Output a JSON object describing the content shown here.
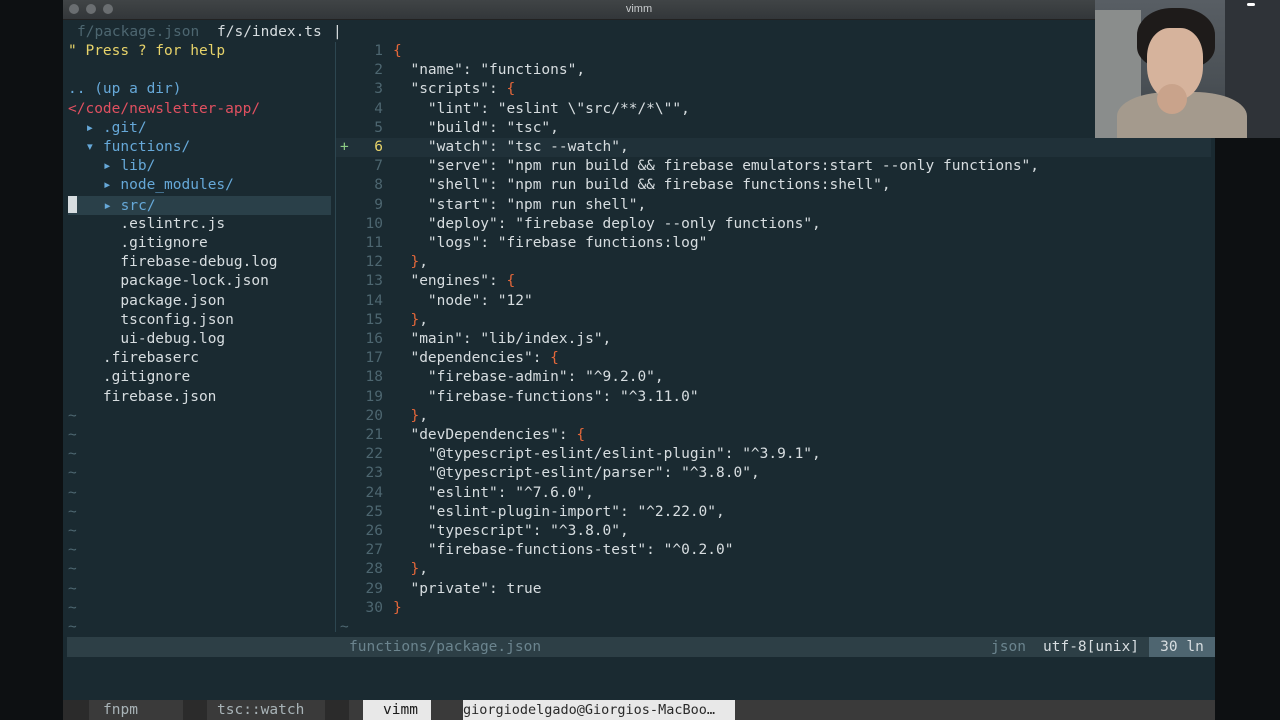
{
  "window": {
    "title": "vimm"
  },
  "tabs": [
    {
      "label": "f/package.json",
      "active": false
    },
    {
      "label": "f/s/index.ts",
      "active": true
    }
  ],
  "tab_separator": "|",
  "tree": {
    "help": "\" Press ? for help",
    "updir": ".. (up a dir)",
    "root": "</code/newsletter-app/",
    "items": [
      {
        "arrow": "▸",
        "label": ".git/",
        "indent": 0,
        "type": "dir"
      },
      {
        "arrow": "▾",
        "label": "functions/",
        "indent": 0,
        "type": "dir"
      },
      {
        "arrow": "▸",
        "label": "lib/",
        "indent": 1,
        "type": "dir"
      },
      {
        "arrow": "▸",
        "label": "node_modules/",
        "indent": 1,
        "type": "dir"
      },
      {
        "arrow": "▸",
        "label": "src/",
        "indent": 1,
        "type": "dir",
        "selected": true
      },
      {
        "arrow": "",
        "label": ".eslintrc.js",
        "indent": 1,
        "type": "file"
      },
      {
        "arrow": "",
        "label": ".gitignore",
        "indent": 1,
        "type": "file"
      },
      {
        "arrow": "",
        "label": "firebase-debug.log",
        "indent": 1,
        "type": "file"
      },
      {
        "arrow": "",
        "label": "package-lock.json",
        "indent": 1,
        "type": "file"
      },
      {
        "arrow": "",
        "label": "package.json",
        "indent": 1,
        "type": "file"
      },
      {
        "arrow": "",
        "label": "tsconfig.json",
        "indent": 1,
        "type": "file"
      },
      {
        "arrow": "",
        "label": "ui-debug.log",
        "indent": 1,
        "type": "file"
      },
      {
        "arrow": "",
        "label": ".firebaserc",
        "indent": 0,
        "type": "file"
      },
      {
        "arrow": "",
        "label": ".gitignore",
        "indent": 0,
        "type": "file"
      },
      {
        "arrow": "",
        "label": "firebase.json",
        "indent": 0,
        "type": "file"
      }
    ],
    "tilde": "~"
  },
  "editor": {
    "current_line": 6,
    "added_sign": "+",
    "lines": [
      "{",
      "  \"name\": \"functions\",",
      "  \"scripts\": {",
      "    \"lint\": \"eslint \\\"src/**/*\\\"\",",
      "    \"build\": \"tsc\",",
      "    \"watch\": \"tsc --watch\",",
      "    \"serve\": \"npm run build && firebase emulators:start --only functions\",",
      "    \"shell\": \"npm run build && firebase functions:shell\",",
      "    \"start\": \"npm run shell\",",
      "    \"deploy\": \"firebase deploy --only functions\",",
      "    \"logs\": \"firebase functions:log\"",
      "  },",
      "  \"engines\": {",
      "    \"node\": \"12\"",
      "  },",
      "  \"main\": \"lib/index.js\",",
      "  \"dependencies\": {",
      "    \"firebase-admin\": \"^9.2.0\",",
      "    \"firebase-functions\": \"^3.11.0\"",
      "  },",
      "  \"devDependencies\": {",
      "    \"@typescript-eslint/eslint-plugin\": \"^3.9.1\",",
      "    \"@typescript-eslint/parser\": \"^3.8.0\",",
      "    \"eslint\": \"^7.6.0\",",
      "    \"eslint-plugin-import\": \"^2.22.0\",",
      "    \"typescript\": \"^3.8.0\",",
      "    \"firebase-functions-test\": \"^0.2.0\"",
      "  },",
      "  \"private\": true",
      "}"
    ],
    "tilde": "~"
  },
  "statusline": {
    "file": "functions/package.json",
    "filetype": "json",
    "encoding": "utf-8[unix]",
    "lines": "30 ln"
  },
  "tmux": {
    "windows": [
      {
        "label": "fnpm",
        "active": false
      },
      {
        "label": "tsc::watch",
        "active": false
      },
      {
        "label": "vimm",
        "active": true
      }
    ],
    "host": "giorgiodelgado@Giorgios-MacBoo…"
  },
  "colors": {
    "background": "#1a2a31",
    "punctuation": "#e4673a",
    "directory": "#66a8d8",
    "root_path": "#e05060",
    "line_number_current": "#e7d36a",
    "git_added": "#8ccc84"
  }
}
